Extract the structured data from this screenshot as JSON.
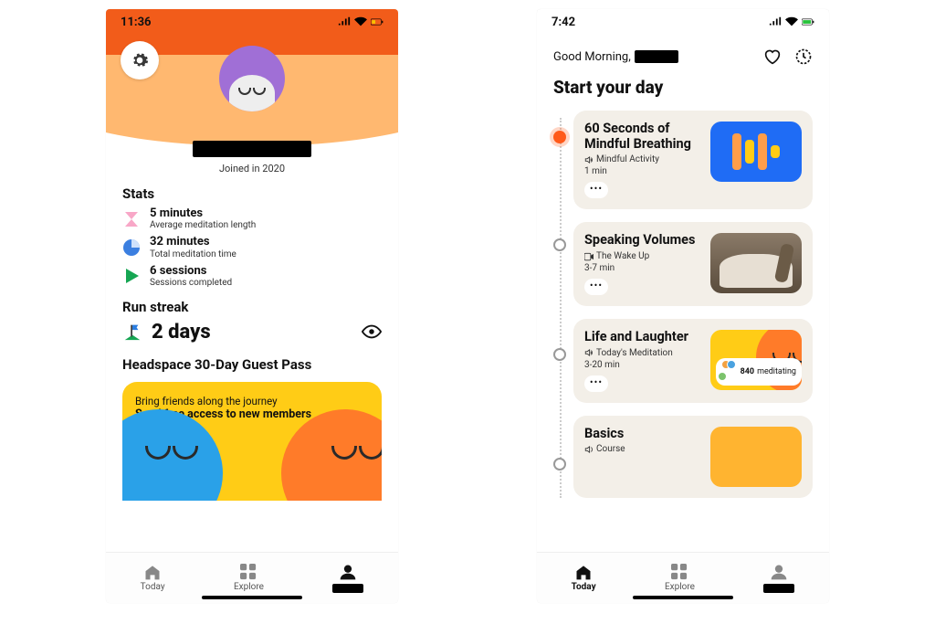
{
  "profile": {
    "status_time": "11:36",
    "joined": "Joined in 2020",
    "stats_heading": "Stats",
    "stats": {
      "avg_value": "5 minutes",
      "avg_label": "Average meditation length",
      "total_value": "32 minutes",
      "total_label": "Total meditation time",
      "sessions_value": "6 sessions",
      "sessions_label": "Sessions completed"
    },
    "streak_heading": "Run streak",
    "streak_value": "2 days",
    "guest_heading": "Headspace 30-Day Guest Pass",
    "guest_line1": "Bring friends along the journey",
    "guest_line2": "Send free access to new members"
  },
  "today": {
    "status_time": "7:42",
    "greeting": "Good Morning,",
    "title": "Start your day",
    "cards": [
      {
        "title": "60 Seconds of Mindful Breathing",
        "subtitle": "Mindful Activity",
        "duration": "1 min"
      },
      {
        "title": "Speaking Volumes",
        "subtitle": "The Wake Up",
        "duration": "3-7 min"
      },
      {
        "title": "Life and Laughter",
        "subtitle": "Today's Meditation",
        "duration": "3-20 min",
        "badge_count": "840",
        "badge_label": "meditating"
      },
      {
        "title": "Basics",
        "subtitle": "Course"
      }
    ]
  },
  "nav": {
    "today": "Today",
    "explore": "Explore"
  }
}
